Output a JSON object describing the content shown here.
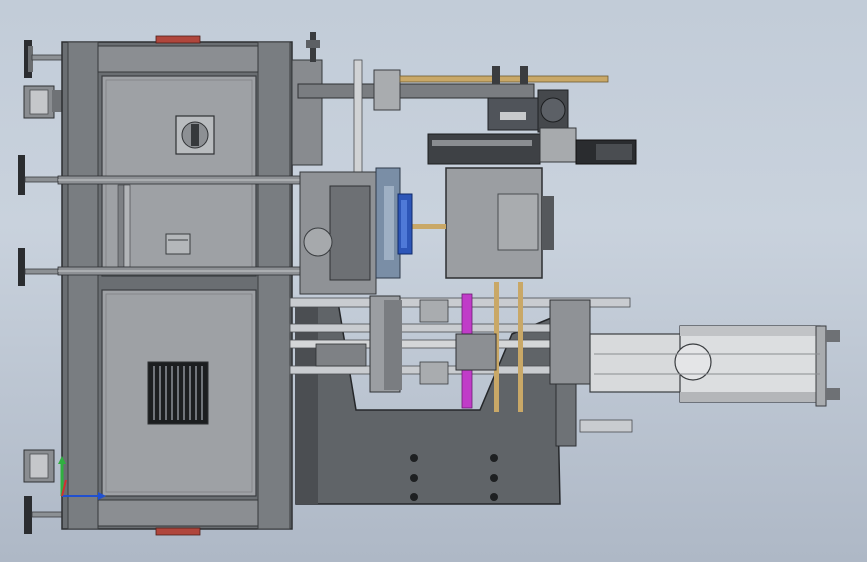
{
  "viewport": {
    "title": ""
  },
  "colors": {
    "background_top": "#c2ccd8",
    "background_bottom": "#aeb8c6",
    "frame_dark": "#5e6266",
    "panel_gray": "#9c9fa3",
    "panel_light": "#aeb1b4",
    "machine_body": "#606468",
    "rod_steel": "#c9ccd0",
    "fan_blue": "#2d56b8",
    "magenta_rod": "#c03cc8",
    "accent_red": "#b0463c",
    "brass": "#c9a867",
    "cylinder_silver": "#d8dadc",
    "axis_x": "#2050d0",
    "axis_y": "#30b040",
    "axis_z": "#d03030"
  },
  "components": [
    "main-cabinet",
    "upper-electrical-panel",
    "main-switch-icon",
    "lower-electrical-panel",
    "ventilation-grille",
    "leveling-feet",
    "tie-rods",
    "servo-motor",
    "gearbox",
    "cooling-fan",
    "heater-block",
    "injection-unit-base",
    "hydraulic-cylinder",
    "guide-rods",
    "linear-rail"
  ],
  "triad": {
    "icon": "coordinate-triad-icon"
  }
}
